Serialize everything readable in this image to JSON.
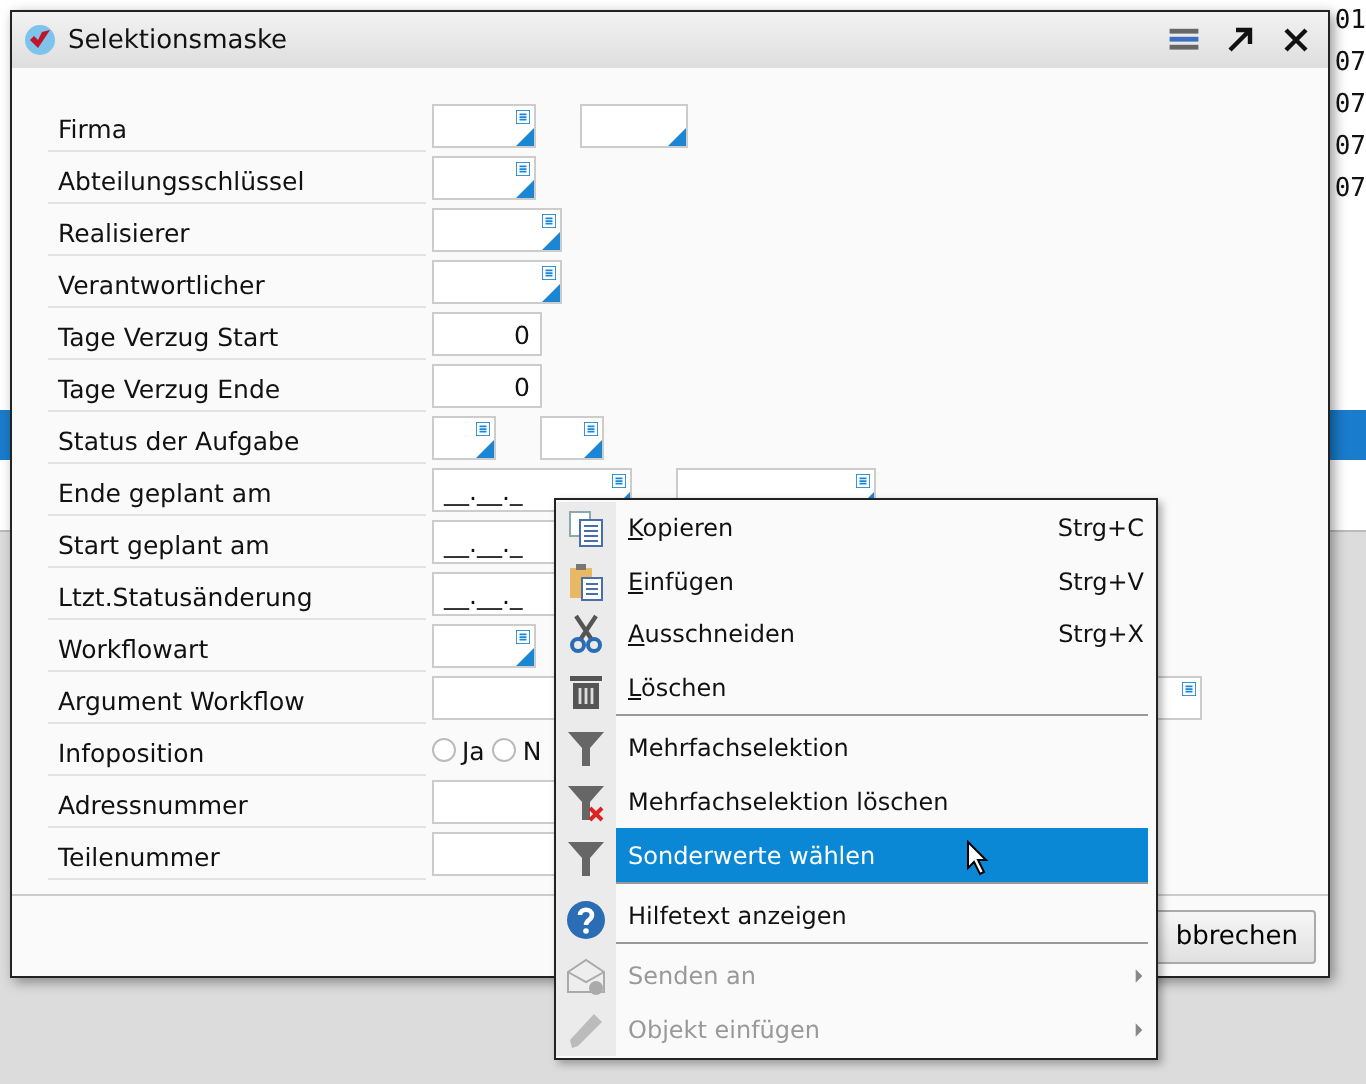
{
  "background": {
    "right_column": [
      "01",
      "07",
      "07",
      "07",
      "07"
    ]
  },
  "window": {
    "title": "Selektionsmaske"
  },
  "form": [
    {
      "label": "Firma",
      "fields": [
        {
          "kind": "lookup"
        },
        {
          "kind": "code"
        }
      ]
    },
    {
      "label": "Abteilungsschlüssel",
      "fields": [
        {
          "kind": "lookup"
        }
      ]
    },
    {
      "label": "Realisierer",
      "fields": [
        {
          "kind": "lookup-wide"
        }
      ]
    },
    {
      "label": "Verantwortlicher",
      "fields": [
        {
          "kind": "lookup-wide"
        }
      ]
    },
    {
      "label": "Tage Verzug Start",
      "fields": [
        {
          "kind": "number",
          "value": "0"
        }
      ]
    },
    {
      "label": "Tage Verzug Ende",
      "fields": [
        {
          "kind": "number",
          "value": "0"
        }
      ]
    },
    {
      "label": "Status der Aufgabe",
      "fields": [
        {
          "kind": "status"
        },
        {
          "kind": "status"
        }
      ]
    },
    {
      "label": "Ende  geplant am",
      "fields": [
        {
          "kind": "date",
          "value": "__.__._"
        },
        {
          "kind": "date"
        }
      ]
    },
    {
      "label": "Start geplant am",
      "fields": [
        {
          "kind": "date-cut",
          "value": "__.__._"
        }
      ]
    },
    {
      "label": "Ltzt.Statusänderung",
      "fields": [
        {
          "kind": "date-cut",
          "value": "__.__._"
        }
      ]
    },
    {
      "label": "Workflowart",
      "fields": [
        {
          "kind": "lookup"
        }
      ]
    },
    {
      "label": "Argument Workflow",
      "fields": [
        {
          "kind": "wide"
        }
      ]
    },
    {
      "label": "Infoposition",
      "fields": [
        {
          "kind": "radio",
          "options": [
            {
              "label": "Ja",
              "selected": false
            },
            {
              "label": "N",
              "selected": false
            }
          ]
        }
      ]
    },
    {
      "label": "Adressnummer",
      "fields": [
        {
          "kind": "text"
        }
      ]
    },
    {
      "label": "Teilenummer",
      "fields": [
        {
          "kind": "text"
        }
      ]
    }
  ],
  "buttons": [
    "bbrechen"
  ],
  "context_menu": [
    {
      "kind": "copy",
      "label": "Kopieren",
      "mnemonic": true,
      "shortcut": "Strg+C",
      "disabled": false,
      "selected": false,
      "submenu": false,
      "separator_after": false
    },
    {
      "kind": "paste",
      "label": "Einfügen",
      "mnemonic": true,
      "shortcut": "Strg+V",
      "disabled": false,
      "selected": false,
      "submenu": false,
      "separator_after": false
    },
    {
      "kind": "cut",
      "label": "Ausschneiden",
      "mnemonic": true,
      "shortcut": "Strg+X",
      "disabled": false,
      "selected": false,
      "submenu": false,
      "separator_after": false
    },
    {
      "kind": "delete",
      "label": "Löschen",
      "mnemonic": true,
      "disabled": false,
      "selected": false,
      "submenu": false,
      "separator_after": true
    },
    {
      "kind": "filter",
      "label": "Mehrfachselektion",
      "mnemonic": false,
      "disabled": false,
      "selected": false,
      "submenu": false,
      "separator_after": false
    },
    {
      "kind": "filter-clear",
      "label": "Mehrfachselektion löschen",
      "mnemonic": false,
      "disabled": false,
      "selected": false,
      "submenu": false,
      "separator_after": false
    },
    {
      "kind": "filter",
      "label": "Sonderwerte wählen",
      "mnemonic": false,
      "disabled": false,
      "selected": true,
      "submenu": false,
      "separator_after": true
    },
    {
      "kind": "help",
      "label": "Hilfetext anzeigen",
      "mnemonic": false,
      "disabled": false,
      "selected": false,
      "submenu": false,
      "separator_after": true
    },
    {
      "kind": "mail",
      "label": "Senden an",
      "mnemonic": false,
      "disabled": true,
      "selected": false,
      "submenu": true,
      "separator_after": false
    },
    {
      "kind": "pen",
      "label": "Objekt einfügen",
      "mnemonic": false,
      "disabled": true,
      "selected": false,
      "submenu": true,
      "separator_after": false
    }
  ]
}
